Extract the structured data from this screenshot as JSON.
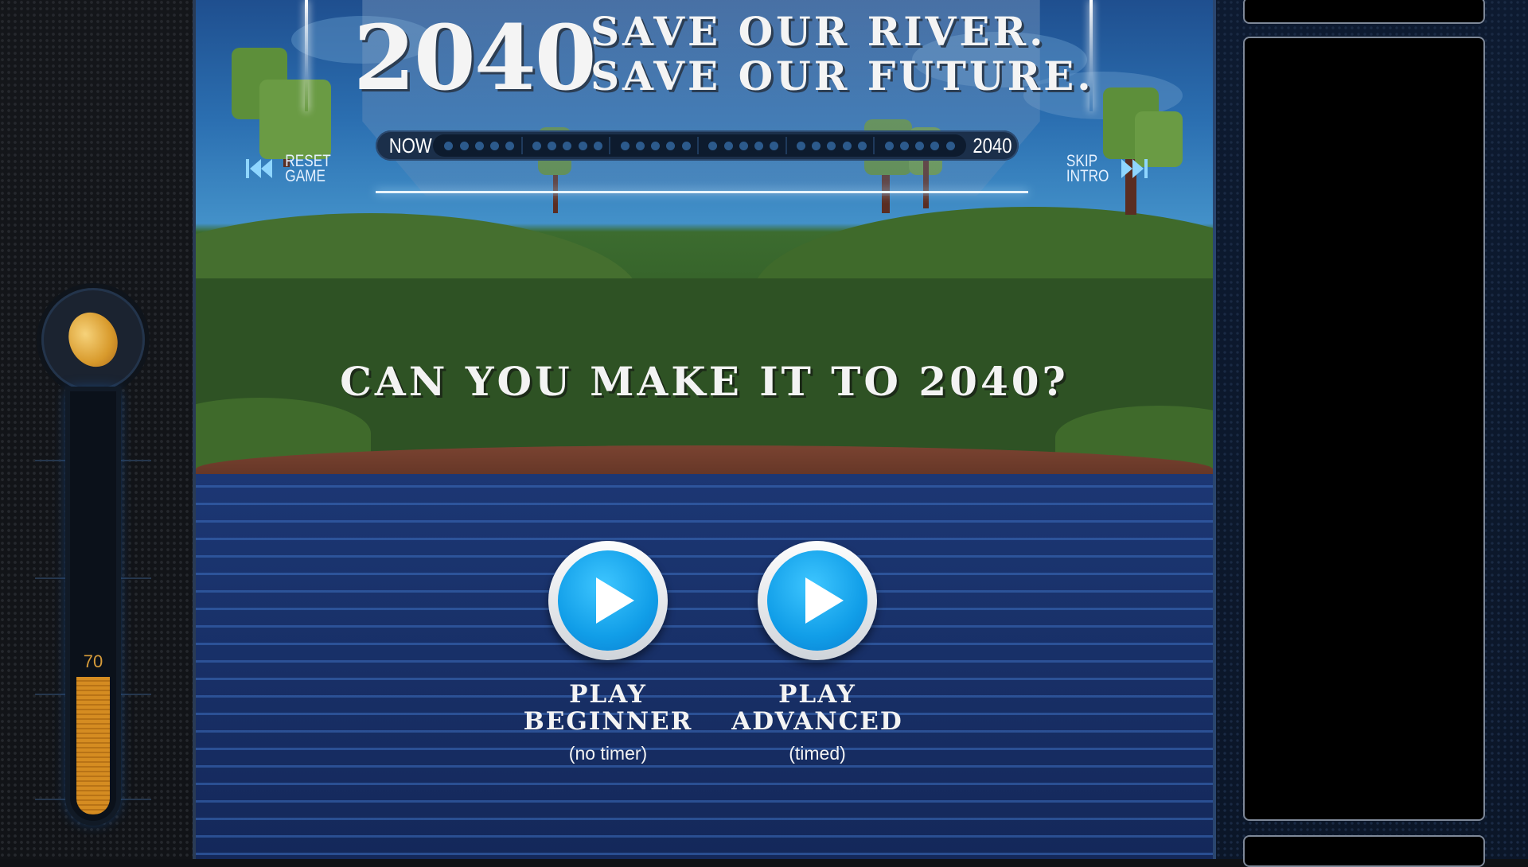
{
  "header": {
    "year": "2040",
    "slogan_line1": "SAVE OUR RIVER.",
    "slogan_line2": "SAVE OUR FUTURE."
  },
  "timeline": {
    "start_label": "NOW",
    "end_label": "2040"
  },
  "controls": {
    "reset_line1": "RESET",
    "reset_line2": "GAME",
    "skip_line1": "SKIP",
    "skip_line2": "INTRO"
  },
  "question": "CAN YOU MAKE IT TO 2040?",
  "modes": {
    "beginner_line1": "PLAY",
    "beginner_line2": "BEGINNER",
    "beginner_sub": "(no timer)",
    "advanced_line1": "PLAY",
    "advanced_line2": "ADVANCED",
    "advanced_sub": "(timed)"
  },
  "gauge": {
    "value": "70",
    "fill_fraction": 0.33,
    "icon": "coin-icon"
  },
  "colors": {
    "accent_blue": "#119ee8",
    "gauge_orange": "#d58c21",
    "water": "#1c3774"
  }
}
